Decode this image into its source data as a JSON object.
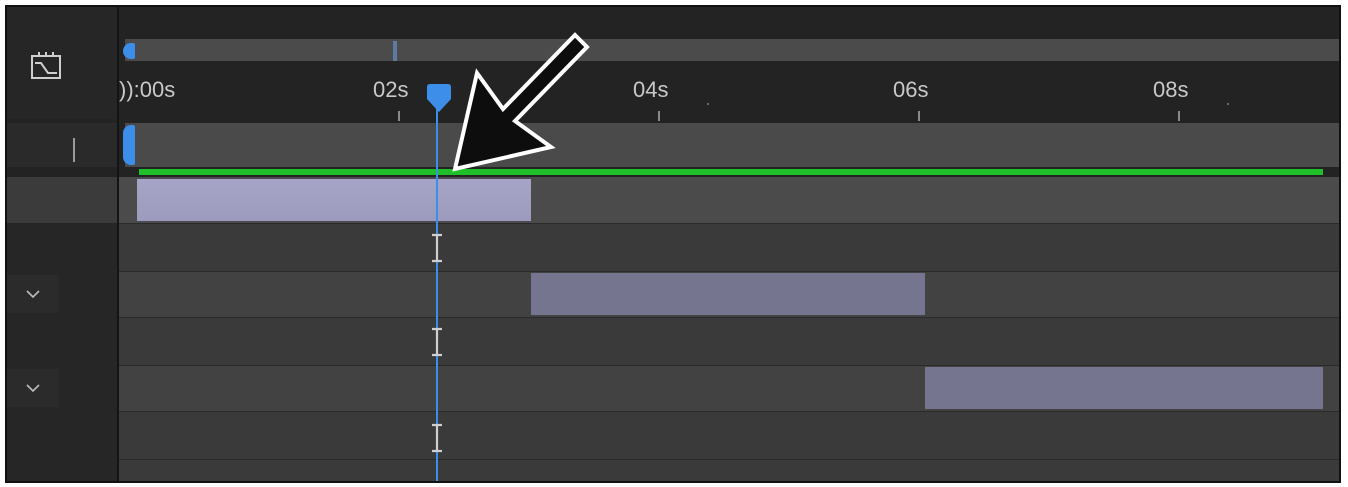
{
  "toolbar": {
    "graph_editor_icon": "graph-editor-icon"
  },
  "timeline": {
    "ruler_labels": [
      ")):00s",
      "02s",
      "04s",
      "06s",
      "08s"
    ],
    "current_time": "02s"
  },
  "layers": [
    {
      "collapse_icon": "chevron-down-icon"
    },
    {
      "collapse_icon": "chevron-down-icon"
    }
  ],
  "colors": {
    "playhead": "#3d8ee8",
    "work_area": "#1fbf2a",
    "clip": "#76758f",
    "clip_selected": "#a7a5c7"
  },
  "annotation": {
    "icon": "pointer-arrow-icon"
  }
}
